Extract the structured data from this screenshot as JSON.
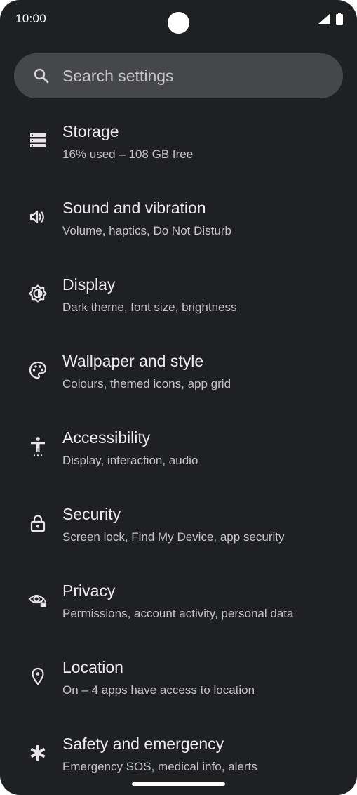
{
  "status_bar": {
    "time": "10:00",
    "icons": [
      "signal-icon",
      "battery-icon"
    ]
  },
  "search": {
    "placeholder": "Search settings",
    "icon": "search-icon"
  },
  "settings": [
    {
      "icon": "storage-icon",
      "title": "Storage",
      "subtitle": "16% used – 108 GB free"
    },
    {
      "icon": "sound-icon",
      "title": "Sound and vibration",
      "subtitle": "Volume, haptics, Do Not Disturb"
    },
    {
      "icon": "display-icon",
      "title": "Display",
      "subtitle": "Dark theme, font size, brightness"
    },
    {
      "icon": "palette-icon",
      "title": "Wallpaper and style",
      "subtitle": "Colours, themed icons, app grid"
    },
    {
      "icon": "accessibility-icon",
      "title": "Accessibility",
      "subtitle": "Display, interaction, audio"
    },
    {
      "icon": "lock-icon",
      "title": "Security",
      "subtitle": "Screen lock, Find My Device, app security"
    },
    {
      "icon": "privacy-eye-icon",
      "title": "Privacy",
      "subtitle": "Permissions, account activity, personal data"
    },
    {
      "icon": "location-pin-icon",
      "title": "Location",
      "subtitle": "On – 4 apps have access to location"
    },
    {
      "icon": "asterisk-icon",
      "title": "Safety and emergency",
      "subtitle": "Emergency SOS, medical info, alerts"
    }
  ],
  "colors": {
    "background": "#1f2022",
    "search_bar": "#46474a",
    "title_text": "#eeeaef",
    "subtitle_text": "#c6c2c8"
  }
}
